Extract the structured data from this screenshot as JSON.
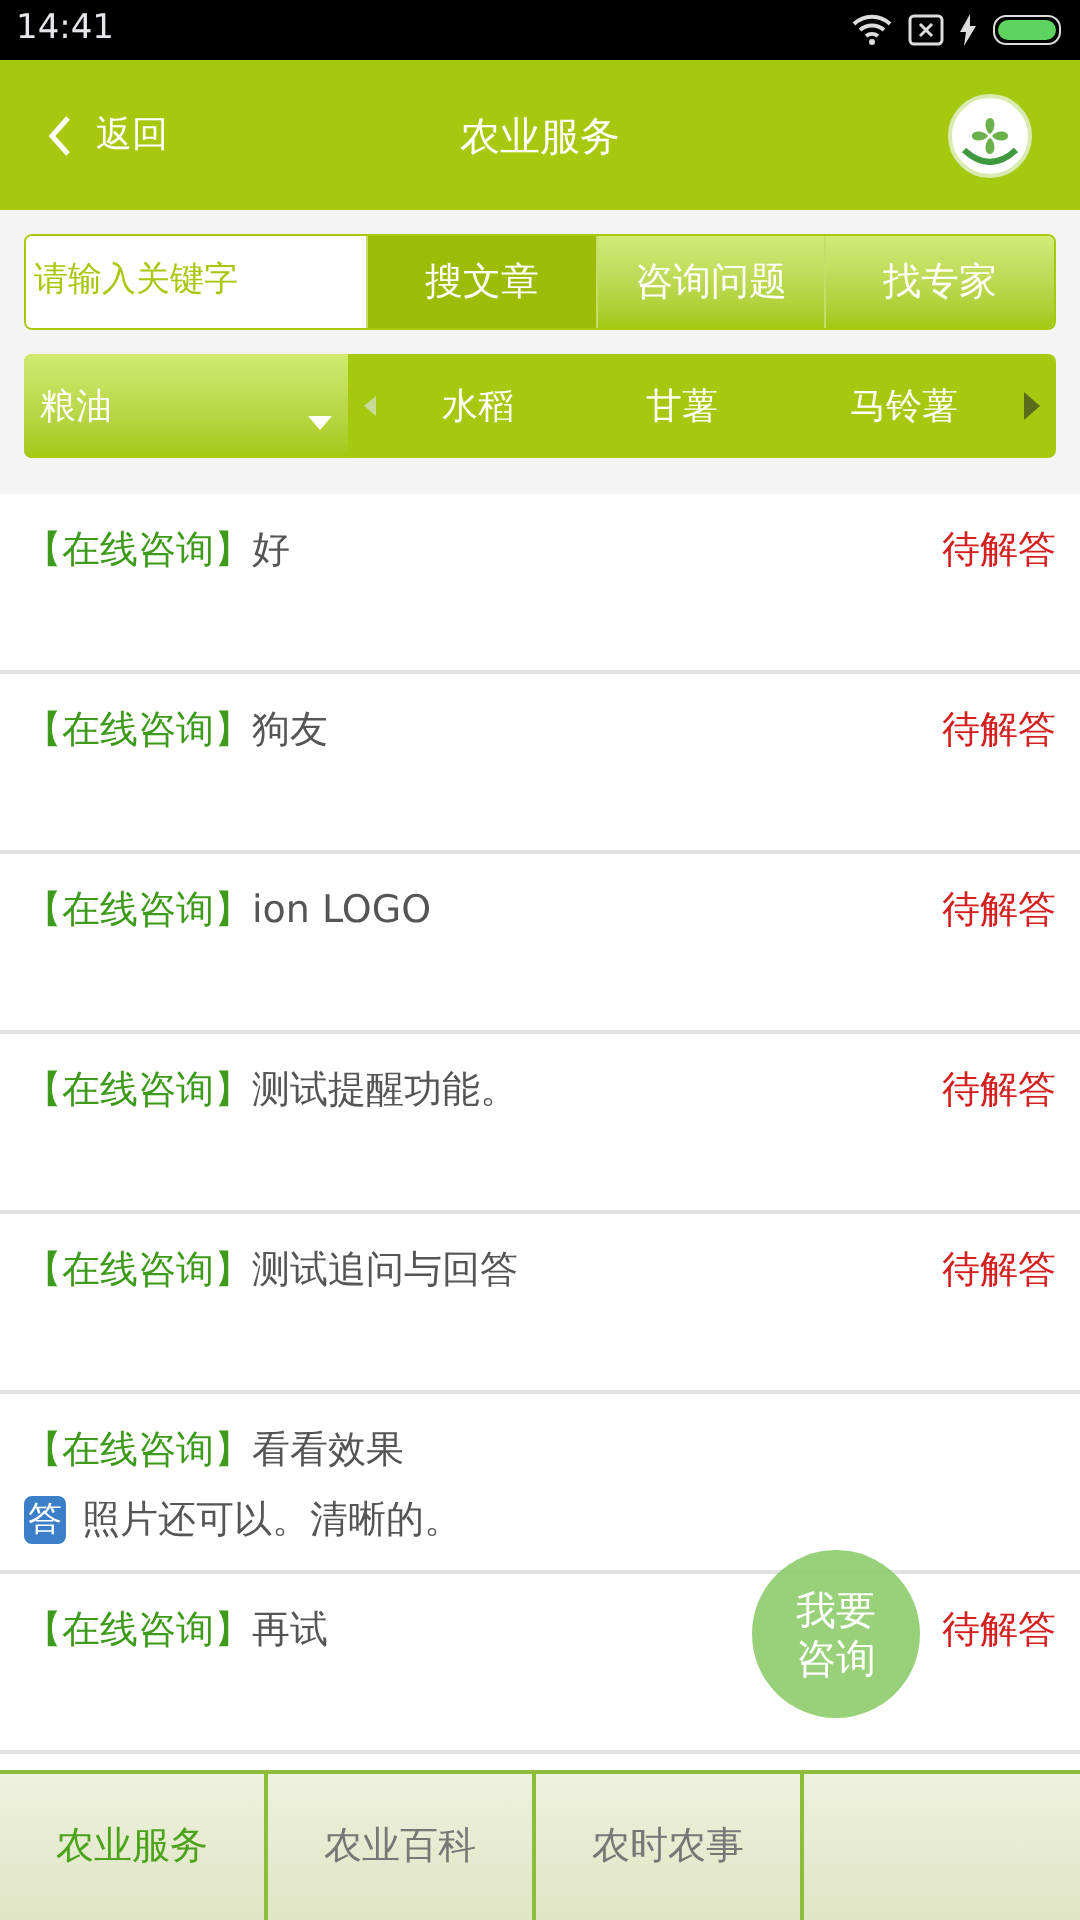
{
  "status_bar": {
    "time": "14:41"
  },
  "header": {
    "back": "返回",
    "title": "农业服务"
  },
  "search": {
    "placeholder": "请输入关键字",
    "buttons": [
      {
        "label": "搜文章",
        "selected": true
      },
      {
        "label": "咨询问题",
        "selected": false
      },
      {
        "label": "找专家",
        "selected": false
      }
    ]
  },
  "category": {
    "dropdown": "粮油",
    "items": [
      "水稻",
      "甘薯",
      "马铃薯"
    ]
  },
  "questions": [
    {
      "tag": "【在线咨询】",
      "title": "好",
      "status": "待解答"
    },
    {
      "tag": "【在线咨询】",
      "title": "狗友",
      "status": "待解答"
    },
    {
      "tag": "【在线咨询】",
      "title": "ion LOGO",
      "status": "待解答"
    },
    {
      "tag": "【在线咨询】",
      "title": "测试提醒功能。",
      "status": "待解答"
    },
    {
      "tag": "【在线咨询】",
      "title": "测试追问与回答",
      "status": "待解答"
    },
    {
      "tag": "【在线咨询】",
      "title": "看看效果",
      "answer_badge": "答",
      "answer": "照片还可以。清晰的。"
    },
    {
      "tag": "【在线咨询】",
      "title": "再试",
      "status": "待解答"
    }
  ],
  "fab": {
    "label": "我要咨询"
  },
  "bottom_tabs": [
    {
      "label": "农业服务",
      "selected": true
    },
    {
      "label": "农业百科",
      "selected": false
    },
    {
      "label": "农时农事",
      "selected": false
    }
  ]
}
